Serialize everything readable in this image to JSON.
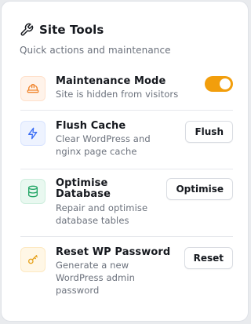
{
  "header": {
    "title": "Site Tools",
    "subtitle": "Quick actions and maintenance",
    "icon": "wrench-icon"
  },
  "tools": [
    {
      "label_lines": [
        "Maintenance Mode"
      ],
      "description_lines": [
        "Site is hidden from visitors"
      ],
      "icon": "hard-hat-icon",
      "control": "toggle",
      "toggle_on": true,
      "accent": "#f29e0c"
    },
    {
      "label_lines": [
        "Flush Cache"
      ],
      "description_lines": [
        "Clear WordPress and",
        "nginx page cache"
      ],
      "icon": "lightning-icon",
      "control": "button",
      "button_label": "Flush",
      "accent": "#3b6ef5"
    },
    {
      "label_lines": [
        "Optimise",
        "Database"
      ],
      "description_lines": [
        "Repair and optimise",
        "database tables"
      ],
      "icon": "database-icon",
      "control": "button",
      "button_label": "Optimise",
      "accent": "#22a565"
    },
    {
      "label_lines": [
        "Reset WP Password"
      ],
      "description_lines": [
        "Generate a new",
        "WordPress admin",
        "password"
      ],
      "icon": "key-icon",
      "control": "button",
      "button_label": "Reset",
      "accent": "#e6a11a"
    }
  ]
}
